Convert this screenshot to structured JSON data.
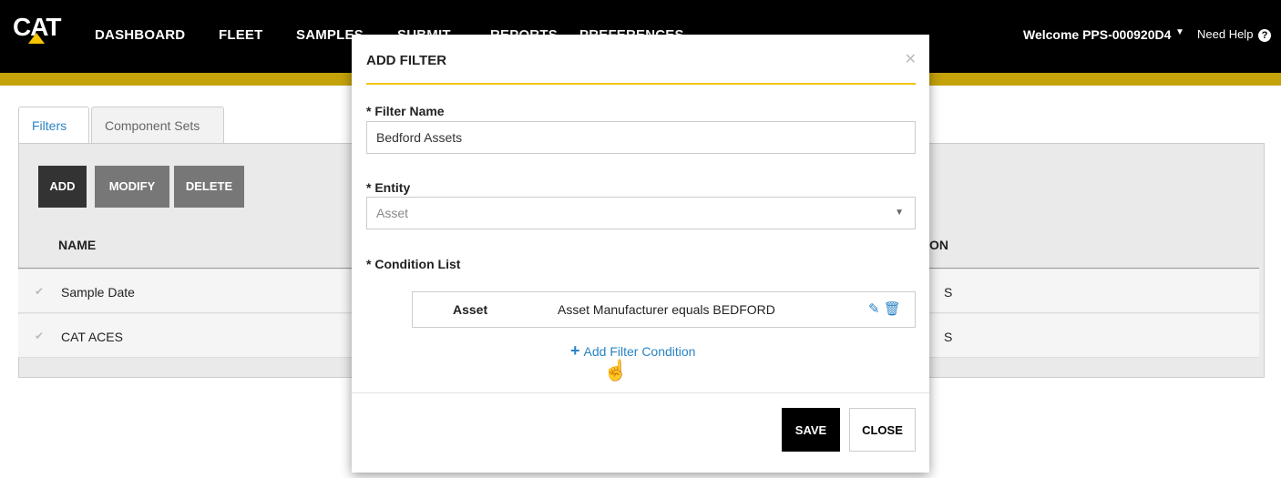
{
  "nav": {
    "logo": "CAT",
    "items": [
      "DASHBOARD",
      "FLEET",
      "SAMPLES",
      "SUBMIT",
      "REPORTS",
      "PREFERENCES"
    ],
    "welcome": "Welcome PPS-000920D4",
    "help": "Need Help"
  },
  "tabs": [
    "Filters",
    "Component Sets"
  ],
  "buttons": {
    "add": "ADD",
    "modify": "MODIFY",
    "delete": "DELETE"
  },
  "table": {
    "columns": [
      "NAME",
      "ON"
    ],
    "rows": [
      {
        "name": "Sample Date",
        "tail": "S"
      },
      {
        "name": "CAT ACES",
        "tail": "S"
      }
    ]
  },
  "modal": {
    "title": "ADD FILTER",
    "filter_name_label": "* Filter Name",
    "filter_name_value": "Bedford Assets",
    "entity_label": "* Entity",
    "entity_value": "Asset",
    "condition_list_label": "* Condition List",
    "conditions": [
      {
        "entity": "Asset",
        "text": "Asset Manufacturer equals BEDFORD"
      }
    ],
    "add_condition": "Add Filter Condition",
    "save": "SAVE",
    "close": "CLOSE"
  },
  "colors": {
    "accent": "#f5c400",
    "link": "#2a83c4",
    "nav_bg": "#000000"
  }
}
